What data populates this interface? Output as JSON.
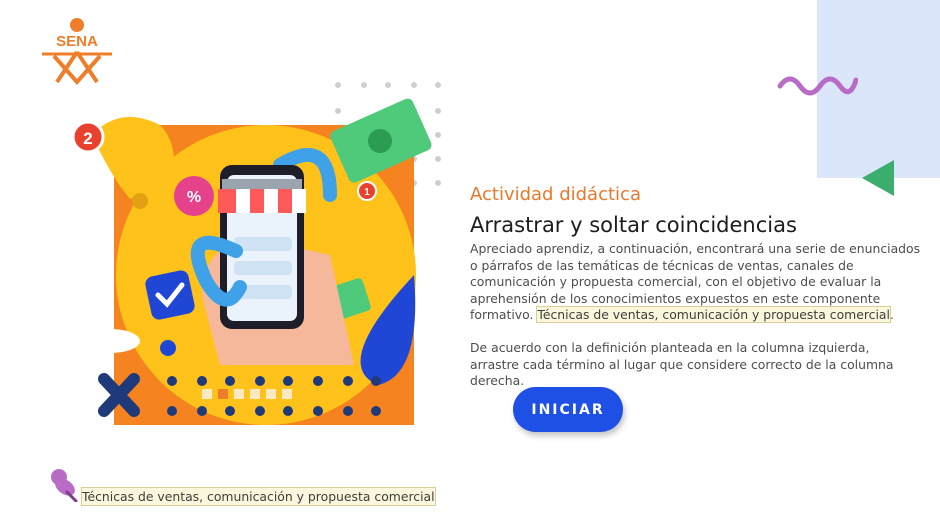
{
  "logo": {
    "text": "SENA",
    "icon": "sena-logo-icon",
    "color": "#ef7d2a"
  },
  "header": {
    "eyebrow": "Actividad didáctica",
    "title": "Arrastrar y soltar coincidencias"
  },
  "content": {
    "paragraph_main": "Apreciado aprendiz, a continuación, encontrará una serie de enunciados o párrafos de las temáticas de técnicas de ventas, canales de comunicación y propuesta comercial, con el objetivo de evaluar la aprehensión de los conocimientos expuestos en este componente formativo.",
    "paragraph_highlight": "Técnicas de ventas, comunicación y propuesta comercial",
    "paragraph_end": ".",
    "instructions": "De acuerdo con la definición planteada en la columna izquierda, arrastre cada término al lugar que considere correcto de la columna derecha."
  },
  "start_button": {
    "label": "INICIAR",
    "color": "#1f50e5"
  },
  "footer": {
    "icon": "pushpin-icon",
    "text": "Técnicas de ventas, comunicación y propuesta comercial"
  },
  "illustration": {
    "notification_count": "2",
    "small_badge_count": "1",
    "discount_symbol": "%",
    "icons": [
      "bell-icon",
      "money-bill-icon",
      "storefront-awning-icon",
      "check-icon",
      "close-x-icon",
      "percent-badge-icon",
      "smartphone-icon"
    ]
  },
  "colors": {
    "accent_orange": "#e8792c",
    "primary_blue": "#1f50e5",
    "panel_blue": "#dce6fb",
    "wave_purple": "#b86cc6",
    "triangle_green": "#3bae6e"
  }
}
